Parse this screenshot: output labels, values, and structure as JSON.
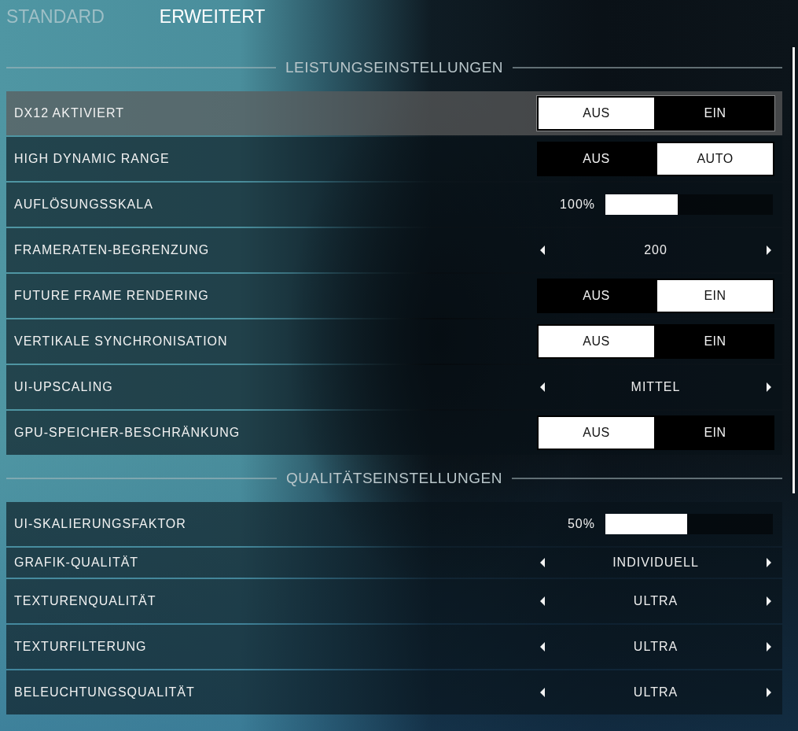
{
  "tabs": [
    {
      "label": "STANDARD",
      "selected": false
    },
    {
      "label": "ERWEITERT",
      "selected": true
    }
  ],
  "sections": [
    {
      "title": "LEISTUNGSEINSTELLUNGEN",
      "rows": [
        {
          "kind": "toggle",
          "label": "DX12 AKTIVIERT",
          "focused": true,
          "options": [
            {
              "label": "AUS",
              "selected": true
            },
            {
              "label": "EIN",
              "selected": false
            }
          ]
        },
        {
          "kind": "toggle",
          "label": "HIGH DYNAMIC RANGE",
          "focused": false,
          "options": [
            {
              "label": "AUS",
              "selected": false
            },
            {
              "label": "AUTO",
              "selected": true
            }
          ]
        },
        {
          "kind": "slider",
          "label": "AUFLÖSUNGSSKALA",
          "focused": false,
          "reading": "100%",
          "level": 0.43
        },
        {
          "kind": "selector",
          "label": "FRAMERATEN-BEGRENZUNG",
          "focused": false,
          "value": "200"
        },
        {
          "kind": "toggle",
          "label": "FUTURE FRAME RENDERING",
          "focused": false,
          "options": [
            {
              "label": "AUS",
              "selected": false
            },
            {
              "label": "EIN",
              "selected": true
            }
          ]
        },
        {
          "kind": "toggle",
          "label": "VERTIKALE SYNCHRONISATION",
          "focused": false,
          "options": [
            {
              "label": "AUS",
              "selected": true
            },
            {
              "label": "EIN",
              "selected": false
            }
          ]
        },
        {
          "kind": "selector",
          "label": "UI-UPSCALING",
          "focused": false,
          "value": "MITTEL"
        },
        {
          "kind": "toggle",
          "label": "GPU-SPEICHER-BESCHRÄNKUNG",
          "focused": false,
          "options": [
            {
              "label": "AUS",
              "selected": true
            },
            {
              "label": "EIN",
              "selected": false
            }
          ]
        }
      ]
    },
    {
      "title": "QUALITÄTSEINSTELLUNGEN",
      "rows": [
        {
          "kind": "slider",
          "label": "UI-SKALIERUNGSFAKTOR",
          "focused": false,
          "reading": "50%",
          "level": 0.49
        },
        {
          "kind": "preset",
          "label": "GRAFIK-QUALITÄT",
          "focused": false,
          "value": "INDIVIDUELL"
        },
        {
          "kind": "selector",
          "label": "TEXTURENQUALITÄT",
          "focused": false,
          "value": "ULTRA"
        },
        {
          "kind": "selector",
          "label": "TEXTURFILTERUNG",
          "focused": false,
          "value": "ULTRA"
        },
        {
          "kind": "selector",
          "label": "BELEUCHTUNGSQUALITÄT",
          "focused": false,
          "value": "ULTRA"
        }
      ]
    }
  ]
}
